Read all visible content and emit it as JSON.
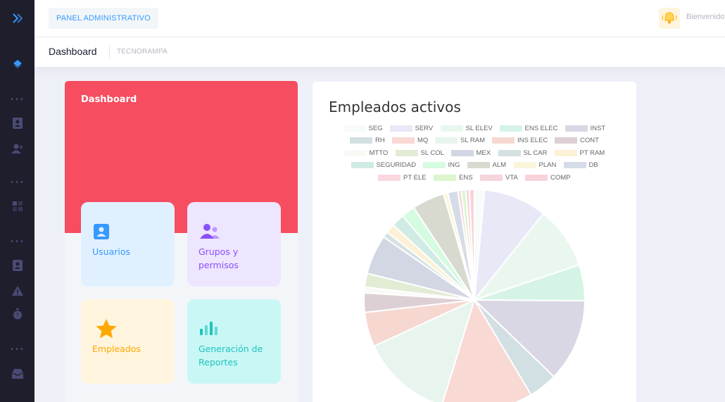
{
  "header": {
    "panel_label": "PANEL ADMINISTRATIVO",
    "welcome_text": "Bienvenido"
  },
  "subheader": {
    "title": "Dashboard",
    "breadcrumb": "TECNORAMPA"
  },
  "sidebar": {
    "icons": [
      "chevrons-right-icon",
      "layers-icon",
      "contact-card-icon",
      "users-icon",
      "grid-icon",
      "contact-card-icon",
      "warning-icon",
      "stopwatch-icon",
      "inbox-icon"
    ]
  },
  "dashboard": {
    "title": "Dashboard",
    "tiles": [
      {
        "label": "Usuarios",
        "icon": "user-card-icon",
        "bg": "#e1f0ff",
        "color": "#3699ff"
      },
      {
        "label": "Grupos y permisos",
        "icon": "group-icon",
        "bg": "#eee5ff",
        "color": "#8950fc"
      },
      {
        "label": "Empleados",
        "icon": "star-icon",
        "bg": "#fff4de",
        "color": "#ffa800"
      },
      {
        "label": "Generación de Reportes",
        "icon": "bar-chart-icon",
        "bg": "#c9f7f5",
        "color": "#1bc5bd"
      }
    ]
  },
  "chart_data": {
    "type": "pie",
    "title": "Empleados activos",
    "legend_position": "top",
    "categories": [
      "SEG",
      "SERV",
      "SL ELEV",
      "ENS ELEC",
      "INST",
      "RH",
      "MQ",
      "SL RAM",
      "INS ELEC",
      "CONT",
      "MTTO",
      "SL COL",
      "MEX",
      "SL CAR",
      "PT RAM",
      "SEGURIDAD",
      "ING",
      "ALM",
      "PLAN",
      "DB",
      "PT ELE",
      "ENS",
      "VTA",
      "COMP"
    ],
    "colors": [
      "#f7fbf9",
      "#e9e8f7",
      "#e9f7ef",
      "#d5f4e6",
      "#d9d7e4",
      "#d2dfe3",
      "#f8d9d3",
      "#e8f5ee",
      "#f6d8d1",
      "#ddd0d4",
      "#f9faf6",
      "#e2ebd4",
      "#d3d6e3",
      "#d5e1e3",
      "#fcf1d5",
      "#d0ebe3",
      "#d5fbe0",
      "#d8dacf",
      "#fbf5da",
      "#d5dce7",
      "#f9d8de",
      "#dcf5cd",
      "#f4d5dc",
      "#f9d3d9"
    ],
    "values": [
      1.4,
      8.8,
      8.7,
      5.0,
      11.5,
      4.0,
      12.7,
      12.7,
      4.8,
      2.7,
      0.8,
      1.9,
      5.5,
      0.8,
      1.3,
      1.8,
      1.9,
      4.5,
      0.6,
      1.4,
      0.5,
      0.6,
      0.5,
      0.7
    ]
  }
}
